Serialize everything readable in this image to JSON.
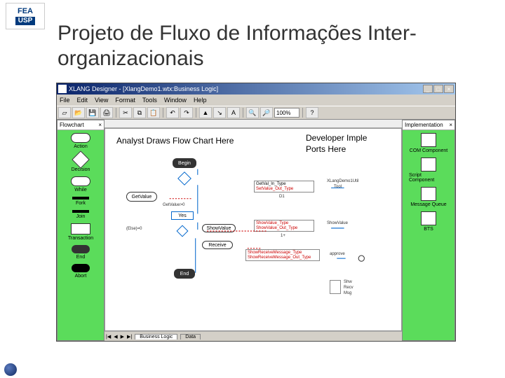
{
  "slide": {
    "title": "Projeto de Fluxo de Informações Inter-organizacionais",
    "logo_top": "FEA",
    "logo_bottom": "USP"
  },
  "app": {
    "titlebar": "XLANG Designer - [XlangDemo1.wtx:Business Logic]",
    "win_min": "_",
    "win_max": "□",
    "win_close": "×",
    "menu": [
      "File",
      "Edit",
      "View",
      "Format",
      "Tools",
      "Window",
      "Help"
    ],
    "zoom": "100%",
    "help_btn": "?",
    "panes": {
      "left_title": "Flowchart",
      "right_title": "Implementation",
      "pin": "×"
    },
    "palette_left": [
      {
        "label": "Action"
      },
      {
        "label": "Decision"
      },
      {
        "label": "While"
      },
      {
        "label": "Fork"
      },
      {
        "label": "Join"
      },
      {
        "label": "Transaction"
      },
      {
        "label": "End"
      },
      {
        "label": "Abort"
      }
    ],
    "palette_right": [
      {
        "label": "COM Component"
      },
      {
        "label": "Script Component"
      },
      {
        "label": "Message Queue"
      },
      {
        "label": "BTS"
      }
    ],
    "canvas": {
      "annotation_left": "Analyst Draws Flow Chart Here",
      "annotation_right_l1": "Developer Imple",
      "annotation_right_l2": "Ports Here",
      "begin": "Begin",
      "getvalue": "GetValue",
      "decision_label": "GetValue>0",
      "yes_label": "Yes",
      "else_label": "(Else)=0",
      "showvalue_node": "ShowValue",
      "receive_node": "Receive",
      "end": "End",
      "port1_a": "GetVal_In_Type",
      "port1_b": "SetValue_Out_Type",
      "port1_id": "D1",
      "port2_a": "ShowValue_Type",
      "port2_b": "ShowValue_Out_Type",
      "port2_id": "1+",
      "port3_a": "ShowReceiveMessage_Type",
      "port3_b": "ShowReceiveMessage_Out_Type",
      "right_col_1a": "XLangDemo1Util",
      "right_col_1b": "Tool",
      "right_col_2": "ShowValue",
      "right_col_3": "approve",
      "right_col_4a": "Shw",
      "right_col_4b": "Recv",
      "right_col_4c": "Msg"
    },
    "tabs": {
      "nav_first": "|◀",
      "nav_prev": "◀",
      "nav_next": "▶",
      "nav_last": "▶|",
      "tab1": "Business Logic",
      "tab2": "Data"
    }
  }
}
